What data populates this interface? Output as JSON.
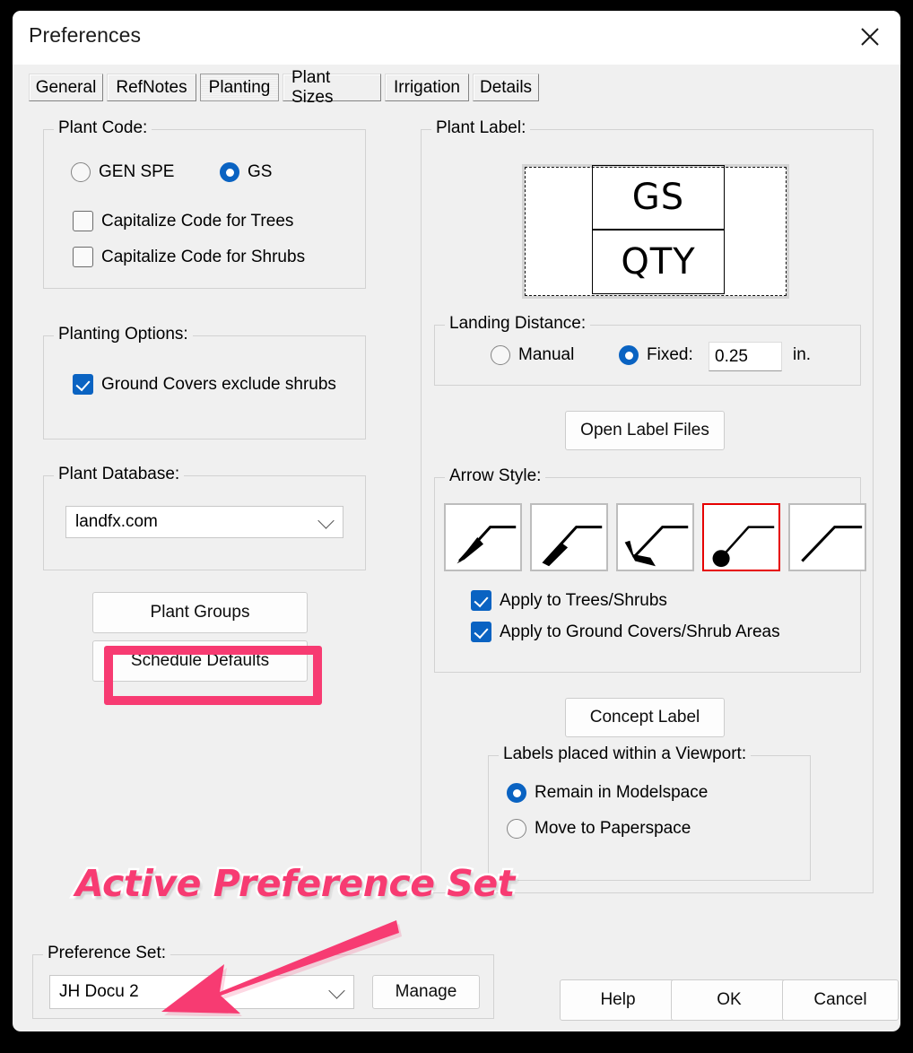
{
  "window": {
    "title": "Preferences",
    "close_icon": "close-icon"
  },
  "tabs": [
    {
      "label": "General",
      "active": false
    },
    {
      "label": "RefNotes",
      "active": false
    },
    {
      "label": "Planting",
      "active": true
    },
    {
      "label": "Plant Sizes",
      "active": false
    },
    {
      "label": "Irrigation",
      "active": false
    },
    {
      "label": "Details",
      "active": false
    }
  ],
  "plant_code": {
    "legend": "Plant Code:",
    "radio_gen_spe": "GEN SPE",
    "radio_gs": "GS",
    "selected": "GS",
    "check_trees": "Capitalize Code for Trees",
    "check_trees_on": false,
    "check_shrubs": "Capitalize Code for Shrubs",
    "check_shrubs_on": false
  },
  "planting_options": {
    "legend": "Planting Options:",
    "check_ground_covers": "Ground Covers exclude shrubs",
    "check_ground_covers_on": true
  },
  "plant_database": {
    "legend": "Plant Database:",
    "value": "landfx.com"
  },
  "left_buttons": {
    "plant_groups": "Plant Groups",
    "schedule_defaults": "Schedule Defaults"
  },
  "plant_label": {
    "legend": "Plant Label:",
    "preview_top": "GS",
    "preview_bottom": "QTY"
  },
  "landing_distance": {
    "legend": "Landing Distance:",
    "radio_manual": "Manual",
    "radio_fixed": "Fixed:",
    "selected": "Fixed",
    "value": "0.25",
    "units": "in."
  },
  "open_label_files": "Open Label Files",
  "arrow_style": {
    "legend": "Arrow Style:",
    "options": [
      {
        "name": "solid-spear-arrowhead"
      },
      {
        "name": "thick-tapered-bar"
      },
      {
        "name": "bent-hook-arrowhead"
      },
      {
        "name": "filled-dot-terminator"
      },
      {
        "name": "plain-line-no-head"
      }
    ],
    "selected_index": 3,
    "check_trees_shrubs": "Apply to Trees/Shrubs",
    "check_trees_shrubs_on": true,
    "check_ground_covers": "Apply to Ground Covers/Shrub Areas",
    "check_ground_covers_on": true
  },
  "concept_label": "Concept Label",
  "viewport": {
    "legend": "Labels placed within a Viewport:",
    "radio_modelspace": "Remain in Modelspace",
    "radio_paperspace": "Move to Paperspace",
    "selected": "Remain in Modelspace"
  },
  "preference_set": {
    "legend": "Preference Set:",
    "value": "JH Docu 2",
    "manage": "Manage"
  },
  "footer": {
    "help": "Help",
    "ok": "OK",
    "cancel": "Cancel"
  },
  "annotation": {
    "text": "Active Preference Set",
    "color": "#f73b72"
  },
  "colors": {
    "accent_blue": "#0a63c2",
    "selection_red": "#e60000",
    "annotation_pink": "#f73b72",
    "window_bg": "#f0f0f0"
  }
}
